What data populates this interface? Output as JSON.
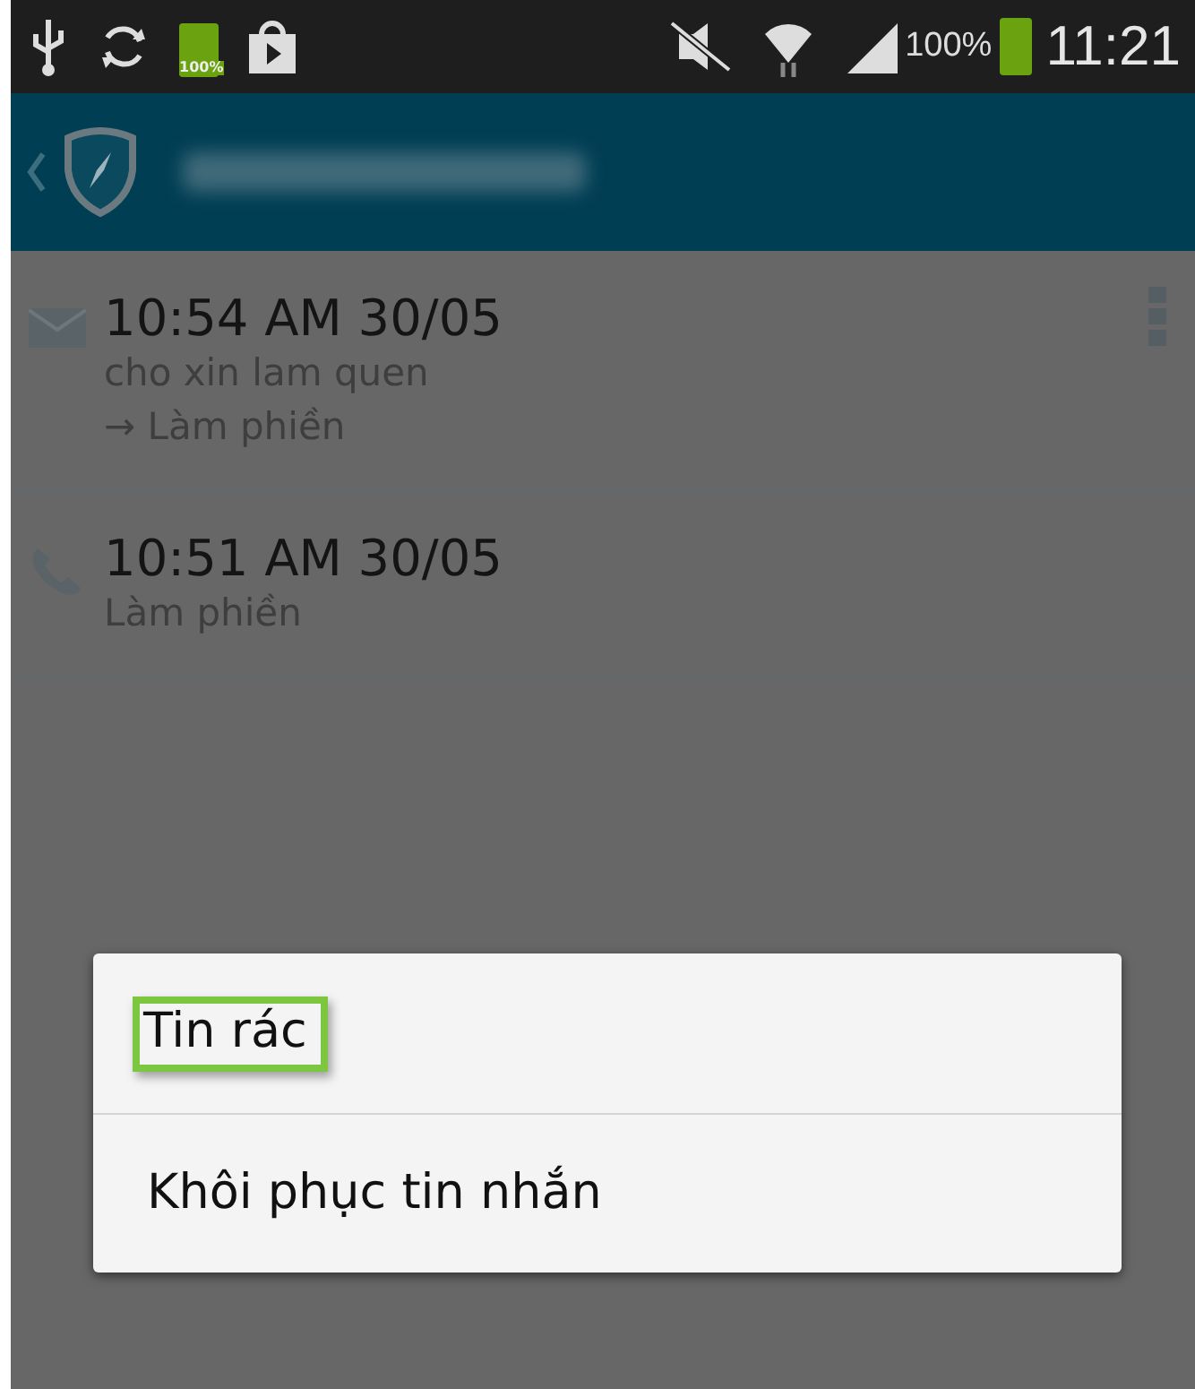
{
  "status_bar": {
    "battery_label": "100%",
    "battery_percent": "100%",
    "time": "11:21"
  },
  "header": {
    "number_blurred": true
  },
  "log": [
    {
      "kind": "sms",
      "time": "10:54 AM 30/05",
      "lines": [
        "cho xin lam quen",
        "→ Làm phiền"
      ],
      "menu": true
    },
    {
      "kind": "call",
      "time": "10:51 AM 30/05",
      "lines": [
        "Làm phiền"
      ],
      "menu": false
    }
  ],
  "context_menu": [
    {
      "label": "Tin rác",
      "highlighted": true
    },
    {
      "label": "Khôi phục tin nhắn",
      "highlighted": false
    }
  ]
}
